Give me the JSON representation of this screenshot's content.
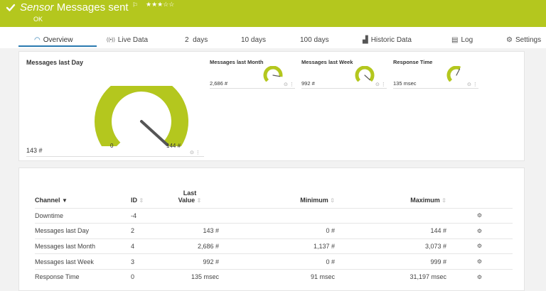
{
  "header": {
    "type": "Sensor",
    "name": "Messages sent",
    "status": "OK",
    "flag": "⚐",
    "stars": "★★★☆☆",
    "background": "#b4c71e"
  },
  "tabs": [
    {
      "label": "Overview",
      "icon": "gauge-icon",
      "glyph": "◠"
    },
    {
      "label": "Live Data",
      "icon": "broadcast-icon",
      "glyph": "((•))"
    },
    {
      "label": "2  days",
      "icon": "",
      "glyph": ""
    },
    {
      "label": "10 days",
      "icon": "",
      "glyph": ""
    },
    {
      "label": "100 days",
      "icon": "",
      "glyph": ""
    },
    {
      "label": "Historic Data",
      "icon": "area-chart-icon",
      "glyph": "▟"
    },
    {
      "label": "Log",
      "icon": "log-icon",
      "glyph": "▤"
    },
    {
      "label": "Settings",
      "icon": "gear-icon",
      "glyph": "⚙"
    }
  ],
  "gauges": {
    "main": {
      "title": "Messages last Day",
      "value": "143 #",
      "min": "0",
      "max": "144 #",
      "fill": 0.99
    },
    "minis": [
      {
        "title": "Messages last Month",
        "value": "2,686 #",
        "fill": 0.87
      },
      {
        "title": "Messages last Week",
        "value": "992 #",
        "fill": 0.99
      },
      {
        "title": "Response Time",
        "value": "135 msec",
        "fill": 0.6
      }
    ],
    "accent": "#b4c71e"
  },
  "table": {
    "headers": {
      "channel": "Channel",
      "id": "ID",
      "last_value_1": "Last",
      "last_value_2": "Value",
      "minimum": "Minimum",
      "maximum": "Maximum"
    },
    "rows": [
      {
        "channel": "Downtime",
        "id": "-4",
        "last": "",
        "min": "",
        "max": ""
      },
      {
        "channel": "Messages last Day",
        "id": "2",
        "last": "143 #",
        "min": "0 #",
        "max": "144 #"
      },
      {
        "channel": "Messages last Month",
        "id": "4",
        "last": "2,686 #",
        "min": "1,137 #",
        "max": "3,073 #"
      },
      {
        "channel": "Messages last Week",
        "id": "3",
        "last": "992 #",
        "min": "0 #",
        "max": "999 #"
      },
      {
        "channel": "Response Time",
        "id": "0",
        "last": "135 msec",
        "min": "91 msec",
        "max": "31,197 msec"
      }
    ]
  }
}
